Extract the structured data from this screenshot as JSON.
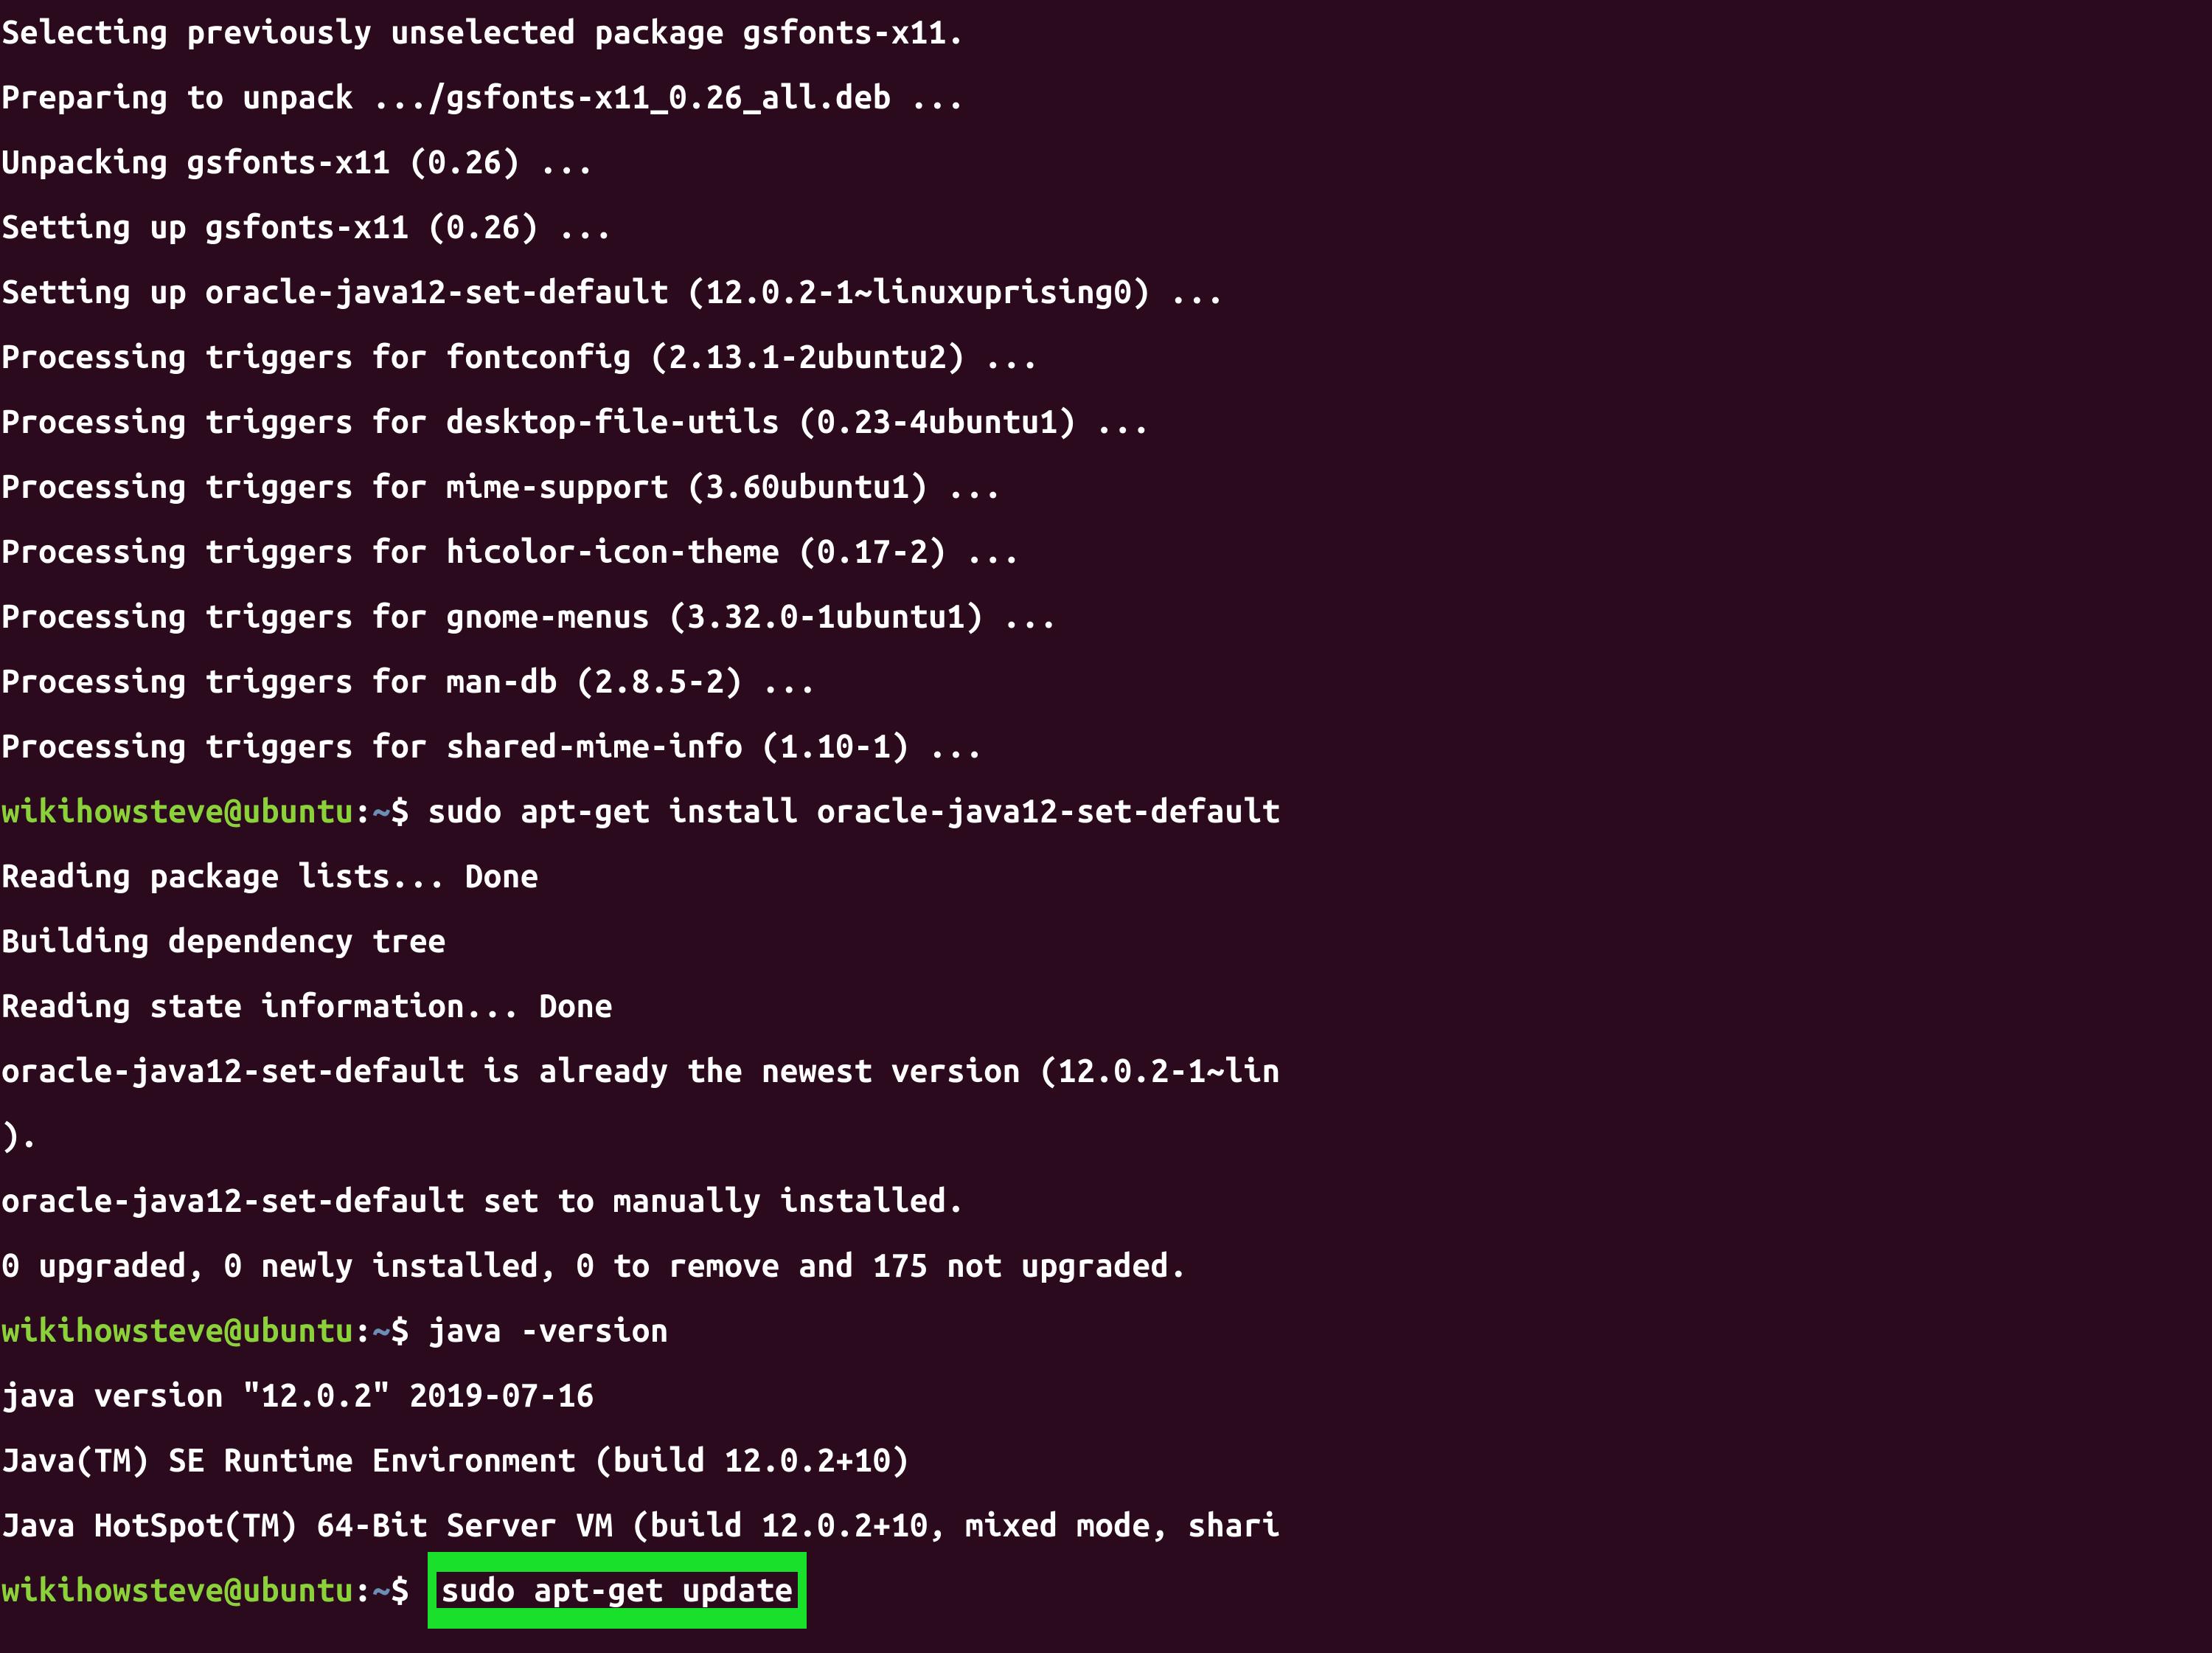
{
  "colors": {
    "background": "#2c0a1e",
    "text": "#ffffff",
    "user": "#8bd13a",
    "path": "#6c8eb4",
    "highlight": "#19e02a"
  },
  "prompt": {
    "user_host": "wikihowsteve@ubuntu",
    "colon": ":",
    "path": "~",
    "dollar": "$"
  },
  "lines": [
    {
      "type": "out",
      "text": "Selecting previously unselected package gsfonts-x11."
    },
    {
      "type": "out",
      "text": "Preparing to unpack .../gsfonts-x11_0.26_all.deb ..."
    },
    {
      "type": "out",
      "text": "Unpacking gsfonts-x11 (0.26) ..."
    },
    {
      "type": "out",
      "text": "Setting up gsfonts-x11 (0.26) ..."
    },
    {
      "type": "out",
      "text": "Setting up oracle-java12-set-default (12.0.2-1~linuxuprising0) ..."
    },
    {
      "type": "out",
      "text": "Processing triggers for fontconfig (2.13.1-2ubuntu2) ..."
    },
    {
      "type": "out",
      "text": "Processing triggers for desktop-file-utils (0.23-4ubuntu1) ..."
    },
    {
      "type": "out",
      "text": "Processing triggers for mime-support (3.60ubuntu1) ..."
    },
    {
      "type": "out",
      "text": "Processing triggers for hicolor-icon-theme (0.17-2) ..."
    },
    {
      "type": "out",
      "text": "Processing triggers for gnome-menus (3.32.0-1ubuntu1) ..."
    },
    {
      "type": "out",
      "text": "Processing triggers for man-db (2.8.5-2) ..."
    },
    {
      "type": "out",
      "text": "Processing triggers for shared-mime-info (1.10-1) ..."
    },
    {
      "type": "cmd",
      "text": "sudo apt-get install oracle-java12-set-default"
    },
    {
      "type": "out",
      "text": "Reading package lists... Done"
    },
    {
      "type": "out",
      "text": "Building dependency tree"
    },
    {
      "type": "out",
      "text": "Reading state information... Done"
    },
    {
      "type": "out",
      "text": "oracle-java12-set-default is already the newest version (12.0.2-1~lin"
    },
    {
      "type": "out",
      "text": ")."
    },
    {
      "type": "out",
      "text": "oracle-java12-set-default set to manually installed."
    },
    {
      "type": "out",
      "text": "0 upgraded, 0 newly installed, 0 to remove and 175 not upgraded."
    },
    {
      "type": "cmd",
      "text": "java -version"
    },
    {
      "type": "out",
      "text": "java version \"12.0.2\" 2019-07-16"
    },
    {
      "type": "out",
      "text": "Java(TM) SE Runtime Environment (build 12.0.2+10)"
    },
    {
      "type": "out",
      "text": "Java HotSpot(TM) 64-Bit Server VM (build 12.0.2+10, mixed mode, shari"
    },
    {
      "type": "cmd_hl",
      "text": "sudo apt-get update"
    }
  ]
}
